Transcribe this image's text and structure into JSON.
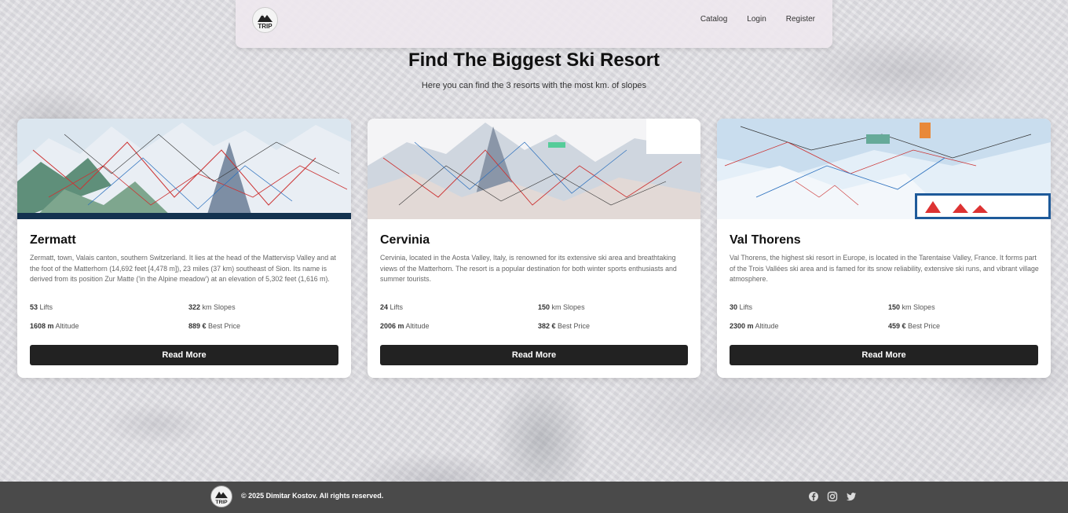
{
  "nav": {
    "logo_text": "TRIP",
    "links": [
      "Catalog",
      "Login",
      "Register"
    ]
  },
  "hero": {
    "title": "Find The Biggest Ski Resort",
    "subtitle": "Here you can find the 3 resorts with the most km. of slopes"
  },
  "resorts": [
    {
      "name": "Zermatt",
      "description": "Zermatt, town, Valais canton, southern Switzerland. It lies at the head of the Mattervisp Valley and at the foot of the Matterhorn (14,692 feet [4,478 m]), 23 miles (37 km) southeast of Sion. Its name is derived from its position Zur Matte ('in the Alpine meadow') at an elevation of 5,302 feet (1,616 m).",
      "lifts": "53",
      "lifts_label": "Lifts",
      "slopes": "322",
      "slopes_label": "km Slopes",
      "altitude": "1608 m",
      "altitude_label": "Altitude",
      "price": "889 €",
      "price_label": "Best Price",
      "button": "Read More"
    },
    {
      "name": "Cervinia",
      "description": "Cervinia, located in the Aosta Valley, Italy, is renowned for its extensive ski area and breathtaking views of the Matterhorn. The resort is a popular destination for both winter sports enthusiasts and summer tourists.",
      "lifts": "24",
      "lifts_label": "Lifts",
      "slopes": "150",
      "slopes_label": "km Slopes",
      "altitude": "2006 m",
      "altitude_label": "Altitude",
      "price": "382 €",
      "price_label": "Best Price",
      "button": "Read More"
    },
    {
      "name": "Val Thorens",
      "description": "Val Thorens, the highest ski resort in Europe, is located in the Tarentaise Valley, France. It forms part of the Trois Vallées ski area and is famed for its snow reliability, extensive ski runs, and vibrant village atmosphere.",
      "lifts": "30",
      "lifts_label": "Lifts",
      "slopes": "150",
      "slopes_label": "km Slopes",
      "altitude": "2300 m",
      "altitude_label": "Altitude",
      "price": "459 €",
      "price_label": "Best Price",
      "button": "Read More"
    }
  ],
  "footer": {
    "logo_text": "TRIP",
    "copyright": "© 2025 Dimitar Kostov. All rights reserved.",
    "social_icons": [
      "facebook-icon",
      "instagram-icon",
      "twitter-icon"
    ]
  }
}
